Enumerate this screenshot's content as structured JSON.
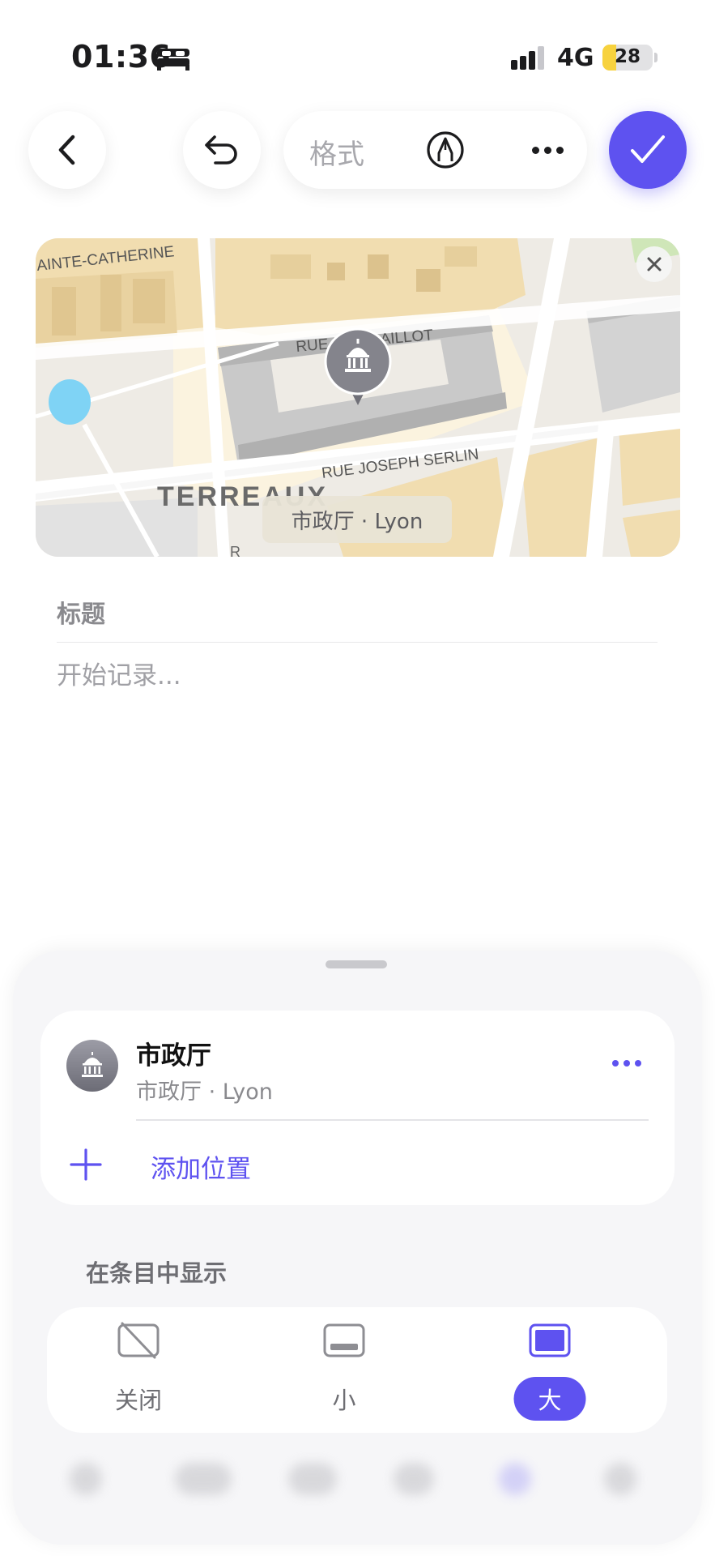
{
  "status_bar": {
    "time": "01:36",
    "network": "4G",
    "battery_level": "28",
    "battery_fraction": 0.28,
    "icons": [
      "bed-icon",
      "signal-icon"
    ]
  },
  "toolbar": {
    "back_icon": "chevron-left-icon",
    "undo_icon": "undo-icon",
    "format_label": "格式",
    "markup_icon": "pen-circle-icon",
    "more_icon": "ellipsis-icon",
    "done_icon": "checkmark-icon"
  },
  "map": {
    "streets": {
      "sainte_catherine": "AINTE-CATHERINE",
      "gaillot": "RUE DES GAILLOT",
      "serlin": "RUE JOSEPH SERLIN",
      "terreaux": "TERREAUX",
      "cut_label": "R"
    },
    "caption": "市政厅 · Lyon",
    "pin_icon": "city-hall-icon",
    "close_icon": "close-icon"
  },
  "note": {
    "title_placeholder": "标题",
    "body_placeholder": "开始记录..."
  },
  "sheet": {
    "location": {
      "name": "市政厅",
      "subtitle": "市政厅 · Lyon",
      "avatar_icon": "city-hall-icon",
      "more_icon": "ellipsis-icon"
    },
    "add_location_label": "添加位置",
    "display_section_title": "在条目中显示",
    "size_options": [
      {
        "label": "关闭",
        "icon": "map-off-icon",
        "selected": false
      },
      {
        "label": "小",
        "icon": "map-small-icon",
        "selected": false
      },
      {
        "label": "大",
        "icon": "map-large-icon",
        "selected": true
      }
    ]
  },
  "colors": {
    "accent": "#5e52f0",
    "battery": "#f7d23e",
    "map_building": "#f1ddb0",
    "map_road": "#ffffff",
    "map_water": "#7fd3f5"
  }
}
